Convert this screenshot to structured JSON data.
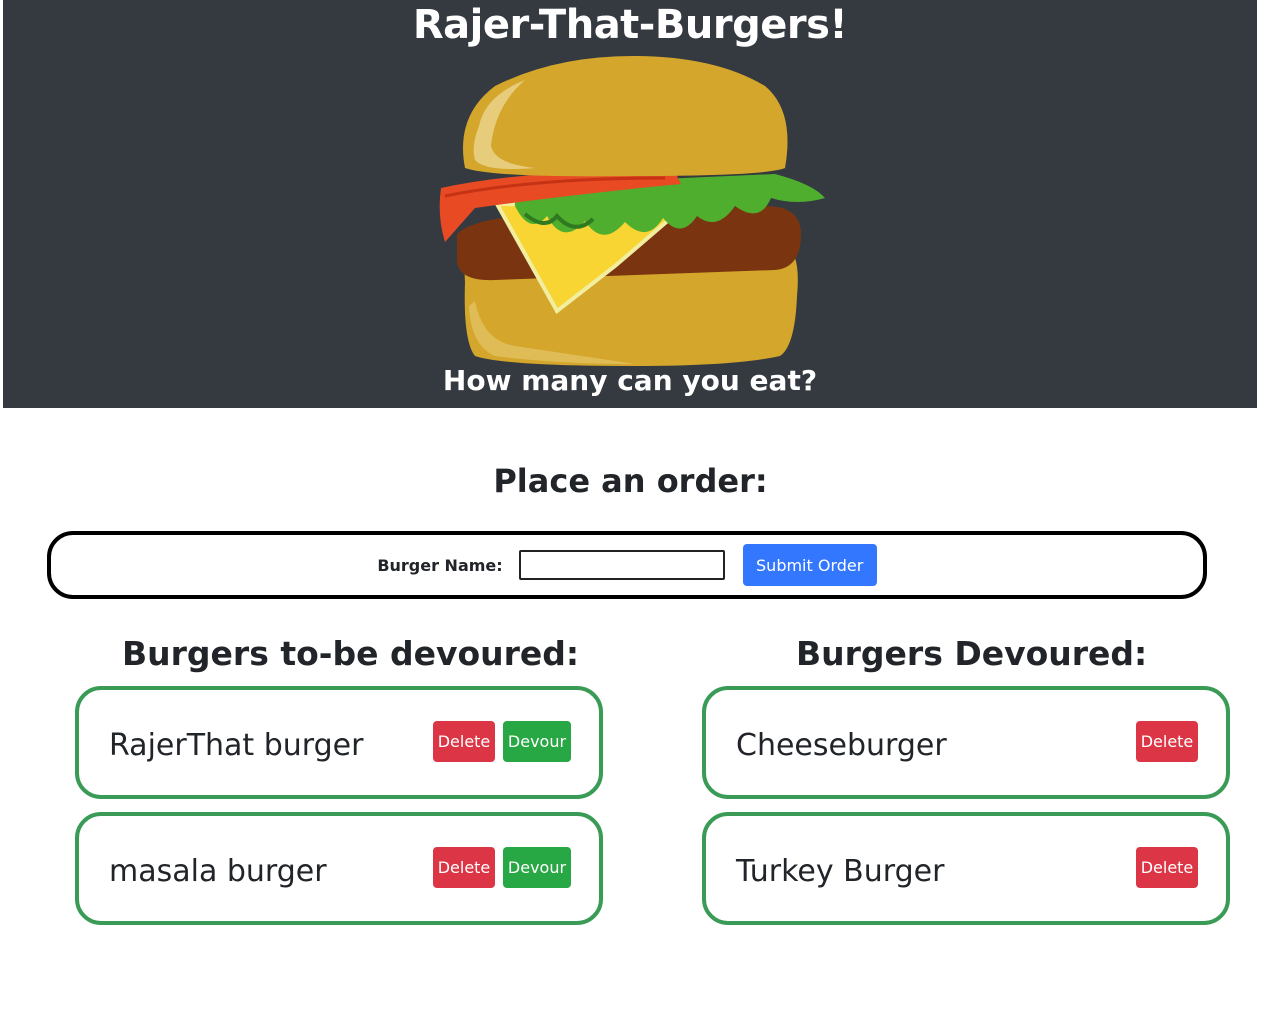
{
  "header": {
    "title": "Rajer-That-Burgers!",
    "tagline": "How many can you eat?"
  },
  "order": {
    "heading": "Place an order:",
    "label": "Burger Name:",
    "input_value": "",
    "submit_label": "Submit Order"
  },
  "to_devour": {
    "heading": "Burgers to-be devoured:",
    "items": [
      {
        "name": "RajerThat burger",
        "delete_label": "Delete",
        "devour_label": "Devour"
      },
      {
        "name": "masala burger",
        "delete_label": "Delete",
        "devour_label": "Devour"
      }
    ]
  },
  "devoured": {
    "heading": "Burgers Devoured:",
    "items": [
      {
        "name": "Cheeseburger",
        "delete_label": "Delete"
      },
      {
        "name": "Turkey Burger",
        "delete_label": "Delete"
      }
    ]
  },
  "colors": {
    "header_bg": "#343a40",
    "primary": "#3377ff",
    "danger": "#dc3545",
    "success": "#28a745",
    "card_border": "#3a9b57"
  }
}
